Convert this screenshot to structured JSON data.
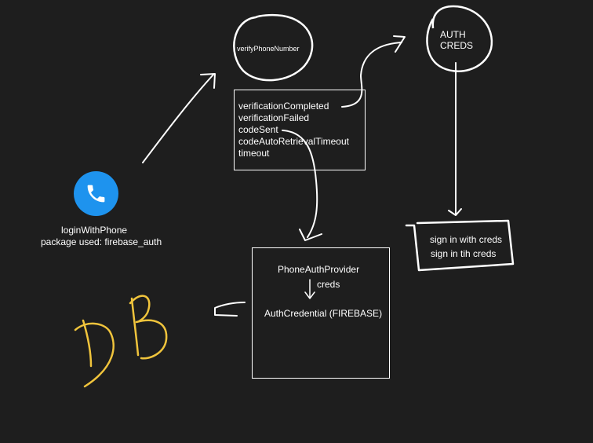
{
  "colors": {
    "background": "#1e1e1e",
    "stroke": "#ffffff",
    "phone_icon_bg": "#1e93ee",
    "handwriting": "#f0c43c"
  },
  "phone": {
    "icon": "phone-icon",
    "title": "loginWithPhone",
    "subtitle": "package used: firebase_auth"
  },
  "verify": {
    "label": "verifyPhoneNumber"
  },
  "callbacks": {
    "items": [
      "verificationCompleted",
      "verificationFailed",
      "codeSent",
      "codeAutoRetrievalTimeout",
      "timeout"
    ]
  },
  "auth_creds": {
    "line1": "AUTH",
    "line2": "CREDS"
  },
  "sign_in": {
    "line1": "sign in with creds",
    "line2": "sign in tih creds"
  },
  "provider": {
    "title": "PhoneAuthProvider",
    "arrow_label": "creds",
    "credential": "AuthCredential (FIREBASE)"
  },
  "db": {
    "label": "DB"
  }
}
